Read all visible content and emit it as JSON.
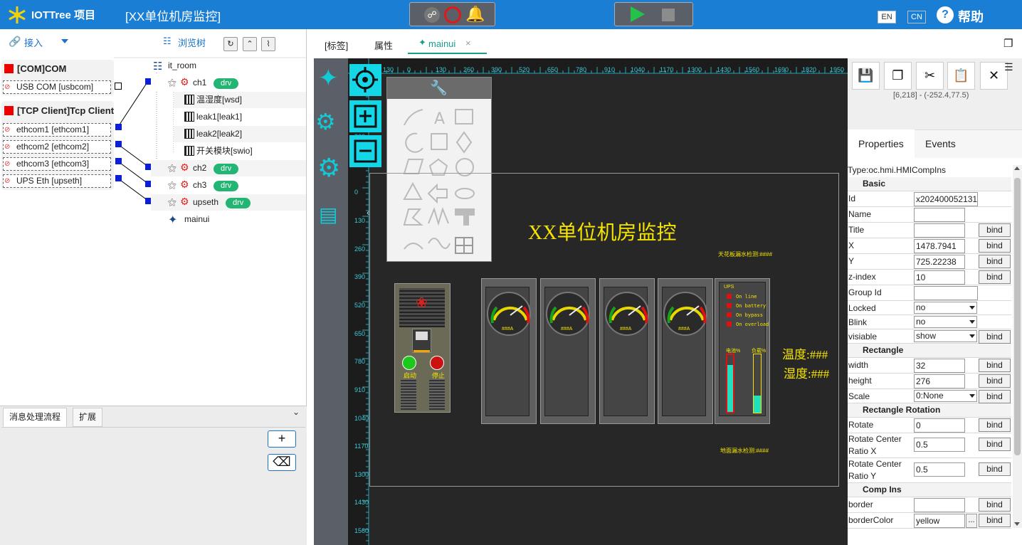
{
  "app": {
    "logo": "IOTTree 项目",
    "project_title": "[XX单位机房监控]",
    "lang_en": "EN",
    "lang_cn": "CN",
    "help": "帮助"
  },
  "left": {
    "access_label": "接入",
    "browse_label": "浏览树",
    "groups": [
      {
        "title": "[COM]COM",
        "items": [
          "USB COM [usbcom]"
        ]
      },
      {
        "title": "[TCP Client]Tcp Client",
        "items": [
          "ethcom1 [ethcom1]",
          "ethcom2 [ethcom2]",
          "ethcom3 [ethcom3]",
          "UPS Eth [upseth]"
        ]
      }
    ],
    "tree": {
      "root": "it_room",
      "rows": [
        {
          "label": "ch1",
          "badge": "drv"
        },
        {
          "label": "温湿度[wsd]"
        },
        {
          "label": "leak1[leak1]"
        },
        {
          "label": "leak2[leak2]"
        },
        {
          "label": "开关模块[swio]"
        },
        {
          "label": "ch2",
          "badge": "drv"
        },
        {
          "label": "ch3",
          "badge": "drv"
        },
        {
          "label": "upseth",
          "badge": "drv"
        },
        {
          "label": "mainui"
        }
      ]
    },
    "bottom_tabs": [
      "消息处理流程",
      "扩展"
    ]
  },
  "center": {
    "tabs": [
      "[标签]",
      "属性",
      "mainui"
    ],
    "ruler_top": [
      "130",
      "0",
      "130",
      "260",
      "390",
      "520",
      "650",
      "780",
      "910",
      "1040",
      "1170",
      "1300",
      "1430",
      "1560",
      "1690",
      "1820",
      "1950"
    ],
    "ruler_left": [
      "260",
      "0",
      "130",
      "260",
      "390",
      "520",
      "650",
      "780",
      "910",
      "1040",
      "1170",
      "1300",
      "1430",
      "1560"
    ],
    "hmi": {
      "title": "XX单位机房监控",
      "ceiling_label": "天花板漏水检测:####",
      "floor_label": "地面漏水检测:####",
      "temp": "温度:###",
      "humid": "湿度:###",
      "start": "启动",
      "stop": "停止",
      "gauge_value": "###A",
      "ups": {
        "label": "UPS",
        "states": [
          "On line",
          "On battery",
          "On bypass",
          "On overload"
        ],
        "bar1": "电池%",
        "bar2": "负载%"
      }
    }
  },
  "right": {
    "coord": "[6,218] - (-252.4,77.5)",
    "tabs": [
      "Properties",
      "Events"
    ],
    "type": "Type:oc.hmi.HMICompIns",
    "rows": [
      {
        "kind": "section",
        "label": "Basic"
      },
      {
        "kind": "input",
        "label": "Id",
        "value": "x202400052131"
      },
      {
        "kind": "input",
        "label": "Name",
        "value": ""
      },
      {
        "kind": "input",
        "label": "Title",
        "value": "",
        "bind": "bind"
      },
      {
        "kind": "input",
        "label": "X",
        "value": "1478.7941",
        "bind": "bind"
      },
      {
        "kind": "input",
        "label": "Y",
        "value": "725.22238",
        "bind": "bind"
      },
      {
        "kind": "input",
        "label": "z-index",
        "value": "10",
        "bind": "bind"
      },
      {
        "kind": "input",
        "label": "Group Id",
        "value": ""
      },
      {
        "kind": "select",
        "label": "Locked",
        "value": "no"
      },
      {
        "kind": "select",
        "label": "Blink",
        "value": "no"
      },
      {
        "kind": "select",
        "label": "visiable",
        "value": "show",
        "bind": "bind"
      },
      {
        "kind": "section",
        "label": "Rectangle"
      },
      {
        "kind": "input",
        "label": "width",
        "value": "32",
        "bind": "bind"
      },
      {
        "kind": "input",
        "label": "height",
        "value": "276",
        "bind": "bind"
      },
      {
        "kind": "select",
        "label": "Scale",
        "value": "0:None",
        "bind": "bind"
      },
      {
        "kind": "section",
        "label": "Rectangle Rotation"
      },
      {
        "kind": "input",
        "label": "Rotate",
        "value": "0",
        "bind": "bind"
      },
      {
        "kind": "input2",
        "label": "Rotate Center Ratio X",
        "value": "0.5",
        "bind": "bind"
      },
      {
        "kind": "input2",
        "label": "Rotate Center Ratio Y",
        "value": "0.5",
        "bind": "bind"
      },
      {
        "kind": "section",
        "label": "Comp Ins"
      },
      {
        "kind": "input",
        "label": "border",
        "value": "",
        "bind": "bind"
      },
      {
        "kind": "input",
        "label": "borderColor",
        "value": "yellow",
        "bind": "bind",
        "dots": "..."
      }
    ]
  }
}
